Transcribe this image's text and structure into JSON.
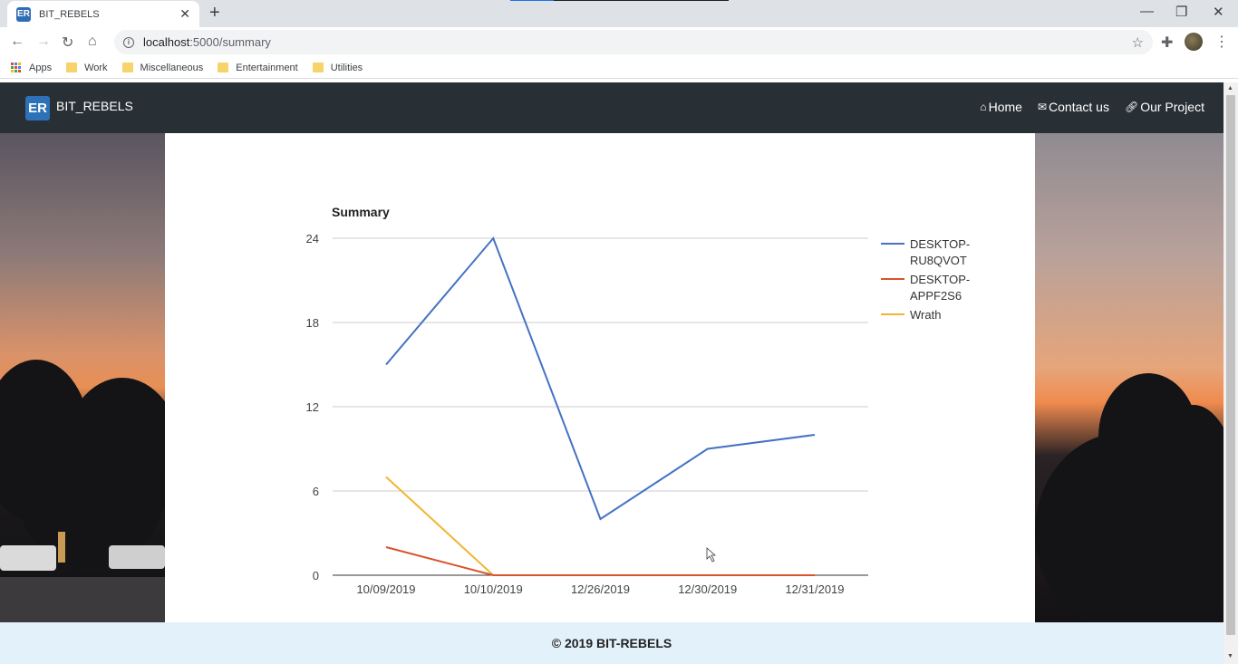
{
  "browser": {
    "tab_title": "BIT_REBELS",
    "tab_favicon_text": "ER",
    "url_host": "localhost",
    "url_path": ":5000/summary",
    "bookmarks": [
      {
        "label": "Apps",
        "icon": "apps-icon"
      },
      {
        "label": "Work",
        "icon": "folder-icon"
      },
      {
        "label": "Miscellaneous",
        "icon": "folder-icon"
      },
      {
        "label": "Entertainment",
        "icon": "folder-icon"
      },
      {
        "label": "Utilities",
        "icon": "folder-icon"
      }
    ]
  },
  "navbar": {
    "brand": "BIT_REBELS",
    "brand_logo_text": "ER",
    "links": [
      {
        "label": "Home",
        "icon": "home-icon"
      },
      {
        "label": "Contact us",
        "icon": "envelope-icon"
      },
      {
        "label": "Our Project",
        "icon": "link-icon"
      }
    ],
    "background": "#293035"
  },
  "footer": {
    "text": "© 2019 BIT-REBELS",
    "background": "#e3f1fb"
  },
  "chart_data": {
    "type": "line",
    "title": "Summary",
    "xlabel": "",
    "ylabel": "",
    "categories": [
      "10/09/2019",
      "10/10/2019",
      "12/26/2019",
      "12/30/2019",
      "12/31/2019"
    ],
    "ylim": [
      0,
      24
    ],
    "yticks": [
      0,
      6,
      12,
      18,
      24
    ],
    "grid": true,
    "legend_position": "right",
    "series": [
      {
        "name": "DESKTOP-RU8QVOT",
        "legend_lines": [
          "DESKTOP-",
          "RU8QVOT"
        ],
        "color": "#4472c4",
        "values": [
          15,
          24,
          4,
          9,
          10
        ]
      },
      {
        "name": "DESKTOP-APPF2S6",
        "legend_lines": [
          "DESKTOP-",
          "APPF2S6"
        ],
        "color": "#d9532b",
        "values": [
          2,
          0,
          0,
          0,
          0
        ]
      },
      {
        "name": "Wrath",
        "legend_lines": [
          "Wrath"
        ],
        "color": "#f2b533",
        "values": [
          7,
          0,
          0,
          0,
          0
        ]
      }
    ]
  }
}
